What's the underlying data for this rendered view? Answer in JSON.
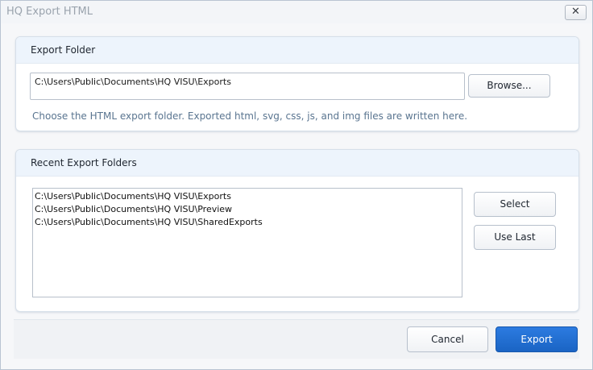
{
  "window": {
    "title": "HQ Export HTML",
    "close_label": "✕"
  },
  "export_folder": {
    "header": "Export Folder",
    "path_value": "C:\\Users\\Public\\Documents\\HQ VISU\\Exports",
    "browse_label": "Browse...",
    "hint": "Choose the HTML export folder. Exported html, svg, css, js, and img files are written here."
  },
  "recent_folders": {
    "header": "Recent Export Folders",
    "items": [
      "C:\\Users\\Public\\Documents\\HQ VISU\\Exports",
      "C:\\Users\\Public\\Documents\\HQ VISU\\Preview",
      "C:\\Users\\Public\\Documents\\HQ VISU\\SharedExports"
    ],
    "select_label": "Select",
    "use_last_label": "Use Last"
  },
  "footer": {
    "cancel_label": "Cancel",
    "export_label": "Export"
  },
  "colors": {
    "accent": "#1a64c4",
    "section_header_bg": "#edf4fc"
  }
}
